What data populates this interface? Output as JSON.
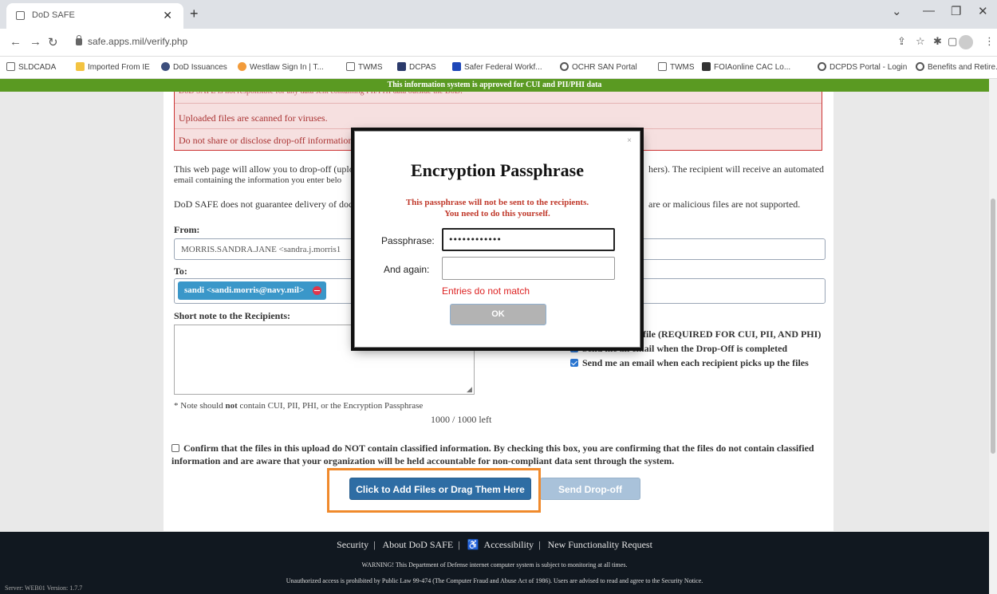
{
  "browser": {
    "tab_title": "DoD SAFE",
    "url": "safe.apps.mil/verify.php",
    "bookmarks": [
      {
        "label": "SLDCADA",
        "icon": "page-icon"
      },
      {
        "label": "Imported From IE",
        "icon": "folder-icon"
      },
      {
        "label": "DoD Issuances",
        "icon": "globe-icon"
      },
      {
        "label": "Westlaw Sign In | T...",
        "icon": "westlaw-icon"
      },
      {
        "label": "TWMS",
        "icon": "page-icon"
      },
      {
        "label": "DCPAS",
        "icon": "star-icon"
      },
      {
        "label": "Safer Federal Workf...",
        "icon": "flag-icon"
      },
      {
        "label": "OCHR SAN Portal",
        "icon": "globe-icon"
      },
      {
        "label": "TWMS",
        "icon": "page-icon"
      },
      {
        "label": "FOIAonline CAC Lo...",
        "icon": "building-icon"
      },
      {
        "label": "DCPDS Portal - Login",
        "icon": "globe-icon"
      },
      {
        "label": "Benefits and Retire...",
        "icon": "globe-icon"
      }
    ],
    "more": "»"
  },
  "banner": "This information system is approved for CUI and PII/PHI data",
  "alerts": {
    "line1": "DoD SAFE is not responsible for any data sent containing PII/PHI data outside the DoD.",
    "line2": "Uploaded files are scanned for viruses.",
    "line3": "Do not share or disclose drop-off information"
  },
  "intro": {
    "p1": "This web page will allow you to drop-off (uplo",
    "p1_end": "hers). The recipient will receive an automated",
    "p1b": "email containing the information you enter belo",
    "p2": "DoD SAFE does not guarantee delivery of doc",
    "p2_end": "are or malicious files are not supported."
  },
  "form": {
    "from_label": "From:",
    "from_value": "MORRIS.SANDRA.JANE <sandra.j.morris1",
    "to_label": "To:",
    "recipient_chip": "sandi <sandi.morris@navy.mil>",
    "note_label": "Short note to the Recipients:",
    "note_hint_prefix": "* Note should ",
    "note_hint_bold": "not",
    "note_hint_suffix": " contain CUI, PII, PHI, or the Encryption Passphrase",
    "char_count": "1000 / 1000 left",
    "encrypt_label": "Encrypt every file (REQUIRED FOR CUI, PII, AND PHI)",
    "email_complete_label": "Send me an email when the Drop-Off is completed",
    "email_pickup_label": "Send me an email when each recipient picks up the files",
    "confirm_label": "Confirm that the files in this upload do NOT contain classified information. By checking this box, you are confirming that the files do not contain classified information and are aware that your organization will be held accountable for non-compliant data sent through the system.",
    "add_files_button": "Click to Add Files or Drag Them Here",
    "send_button": "Send Drop-off"
  },
  "modal": {
    "title": "Encryption Passphrase",
    "warning_line1": "This passphrase will not be sent to the recipients.",
    "warning_line2": "You need to do this yourself.",
    "passphrase_label": "Passphrase:",
    "passphrase_value": "••••••••••••",
    "again_label": "And again:",
    "again_value": "",
    "error": "Entries do not match",
    "ok_button": "OK",
    "close": "×"
  },
  "footer": {
    "links": [
      "Security",
      "About DoD SAFE",
      "Accessibility",
      "New Functionality Request"
    ],
    "separator": "|",
    "warning1": "WARNING! This Department of Defense internet computer system is subject to monitoring at all times.",
    "warning2": "Unauthorized access is prohibited by Public Law 99-474 (The Computer Fraud and Abuse Act of 1986). Users are advised to read and agree to the Security Notice.",
    "server": "Server: WEB01   Version: 1.7.7"
  },
  "colors": {
    "banner": "#5a9a22",
    "primary_button": "#2e6da4",
    "highlight_box": "#f08a2c",
    "error": "#c0392b"
  }
}
